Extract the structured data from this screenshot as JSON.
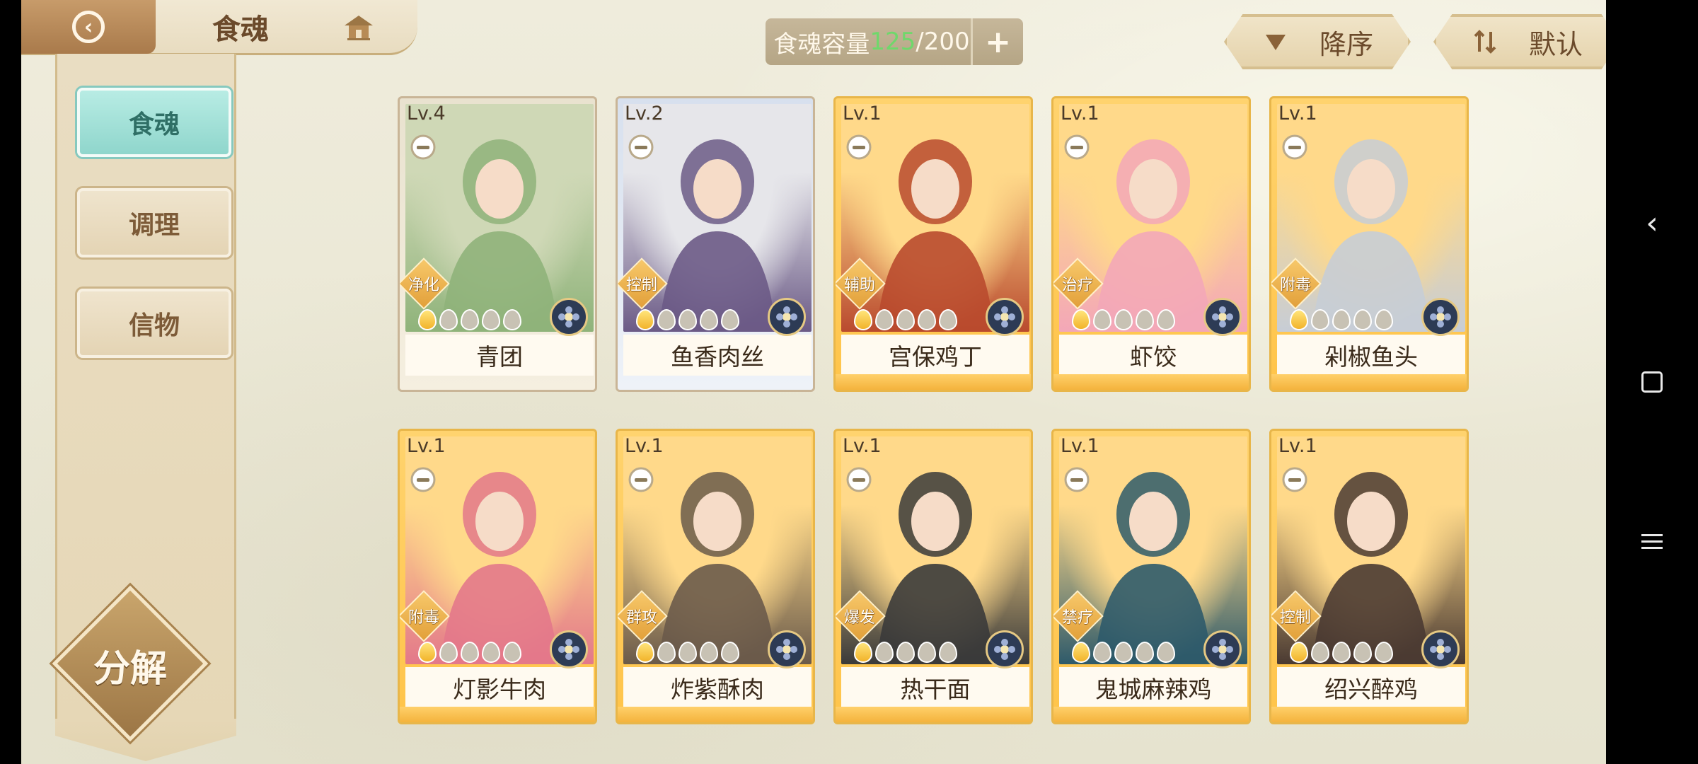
{
  "header": {
    "title": "食魂"
  },
  "sidebar": {
    "tabs": [
      {
        "label": "食魂",
        "active": true
      },
      {
        "label": "调理",
        "active": false
      },
      {
        "label": "信物",
        "active": false
      }
    ],
    "decompose_label": "分解"
  },
  "capacity": {
    "label": "食魂容量",
    "current": "125",
    "max": "/200",
    "plus_label": "+"
  },
  "sort": {
    "order_label": "降序",
    "default_label": "默认"
  },
  "colors": {
    "accent_teal": "#8fd6cc",
    "gold_card": "#ffc44a",
    "capacity_current": "#6fd86b",
    "brown_text": "#6b4a2b"
  },
  "cards": [
    {
      "level": "Lv.4",
      "name": "青团",
      "role": "净化",
      "stars": 1,
      "frame": "green",
      "element": "flower-icon"
    },
    {
      "level": "Lv.2",
      "name": "鱼香肉丝",
      "role": "控制",
      "stars": 1,
      "frame": "blue",
      "element": "flower-icon"
    },
    {
      "level": "Lv.1",
      "name": "宫保鸡丁",
      "role": "辅助",
      "stars": 1,
      "frame": "gold",
      "element": "leaf-icon"
    },
    {
      "level": "Lv.1",
      "name": "虾饺",
      "role": "治疗",
      "stars": 1,
      "frame": "gold",
      "element": "flame-icon"
    },
    {
      "level": "Lv.1",
      "name": "剁椒鱼头",
      "role": "附毒",
      "stars": 1,
      "frame": "gold",
      "element": "flame-icon"
    },
    {
      "level": "Lv.1",
      "name": "灯影牛肉",
      "role": "附毒",
      "stars": 1,
      "frame": "gold",
      "element": "flower-icon"
    },
    {
      "level": "Lv.1",
      "name": "炸紫酥肉",
      "role": "群攻",
      "stars": 1,
      "frame": "gold",
      "element": "flower-icon"
    },
    {
      "level": "Lv.1",
      "name": "热干面",
      "role": "爆发",
      "stars": 1,
      "frame": "gold",
      "element": "flower-icon"
    },
    {
      "level": "Lv.1",
      "name": "鬼城麻辣鸡",
      "role": "禁疗",
      "stars": 1,
      "frame": "gold",
      "element": "flame-icon"
    },
    {
      "level": "Lv.1",
      "name": "绍兴醉鸡",
      "role": "控制",
      "stars": 1,
      "frame": "gold",
      "element": "flower-icon"
    }
  ]
}
